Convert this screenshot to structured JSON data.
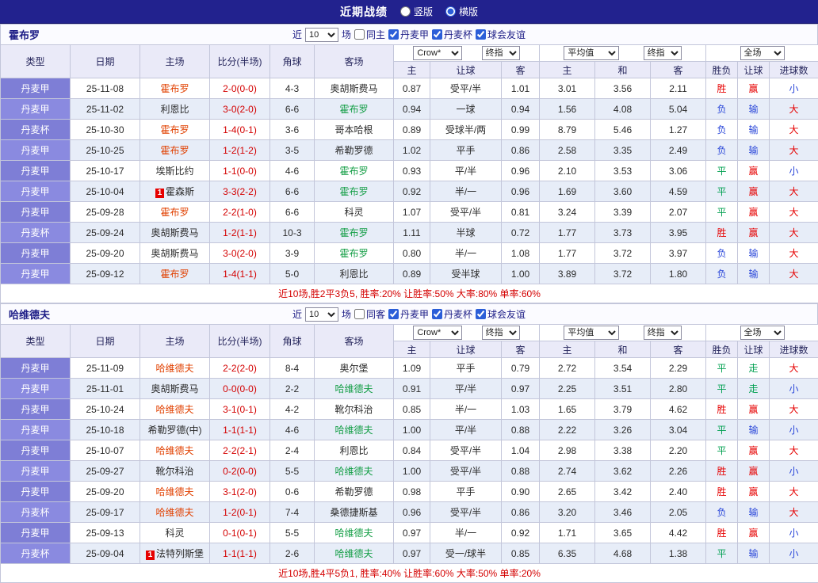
{
  "topbar": {
    "title": "近期战绩",
    "vertical_label": "竖版",
    "horizontal_label": "横版",
    "vertical_checked": false,
    "horizontal_checked": true
  },
  "columns": {
    "type": "类型",
    "date": "日期",
    "home": "主场",
    "score": "比分(半场)",
    "corner": "角球",
    "away": "客场",
    "asian_home": "主",
    "asian_line": "让球",
    "asian_away": "客",
    "euro_home": "主",
    "euro_draw": "和",
    "euro_away": "客",
    "outcome": "胜负",
    "handicap_result": "让球",
    "goals": "进球数"
  },
  "colors": {
    "topbar_bg": "#22228e",
    "type_cell": "#7e7ed6",
    "alt_row": "#e7edf8",
    "win_red": "#e60000",
    "draw_green": "#00a050",
    "lose_blue": "#2946d9",
    "score_red": "#d40000",
    "home_team_red": "#e14000",
    "away_team_green": "#149e46"
  },
  "sections": [
    {
      "team": "霍布罗",
      "filter": {
        "near": "近",
        "count": "10",
        "games": "场",
        "items": [
          {
            "label": "同主",
            "checked": false
          },
          {
            "label": "丹麦甲",
            "checked": true
          },
          {
            "label": "丹麦杯",
            "checked": true
          },
          {
            "label": "球会友谊",
            "checked": true
          }
        ]
      },
      "dropdowns": {
        "bookmaker": "Crow*",
        "asian_index": "终指",
        "euro_source": "平均值",
        "euro_index": "终指",
        "scope": "全场"
      },
      "rows": [
        {
          "type": "丹麦甲",
          "date": "25-11-08",
          "home": "霍布罗",
          "home_color": "red",
          "score": "2-0(0-0)",
          "corner": "4-3",
          "away": "奥胡斯费马",
          "ah": "0.87",
          "line": "受平/半",
          "aa": "1.01",
          "eh": "3.01",
          "ed": "3.56",
          "ea": "2.11",
          "wl": "胜",
          "hr": "赢",
          "goals": "小"
        },
        {
          "type": "丹麦甲",
          "date": "25-11-02",
          "home": "利恩比",
          "score": "3-0(2-0)",
          "corner": "6-6",
          "away": "霍布罗",
          "away_color": "green",
          "ah": "0.94",
          "line": "一球",
          "aa": "0.94",
          "eh": "1.56",
          "ed": "4.08",
          "ea": "5.04",
          "wl": "负",
          "hr": "输",
          "goals": "大"
        },
        {
          "type": "丹麦杯",
          "date": "25-10-30",
          "home": "霍布罗",
          "home_color": "red",
          "score": "1-4(0-1)",
          "corner": "3-6",
          "away": "哥本哈根",
          "ah": "0.89",
          "line": "受球半/两",
          "aa": "0.99",
          "eh": "8.79",
          "ed": "5.46",
          "ea": "1.27",
          "wl": "负",
          "hr": "输",
          "goals": "大"
        },
        {
          "type": "丹麦甲",
          "date": "25-10-25",
          "home": "霍布罗",
          "home_color": "red",
          "score": "1-2(1-2)",
          "corner": "3-5",
          "away": "希勒罗德",
          "ah": "1.02",
          "line": "平手",
          "aa": "0.86",
          "eh": "2.58",
          "ed": "3.35",
          "ea": "2.49",
          "wl": "负",
          "hr": "输",
          "goals": "大"
        },
        {
          "type": "丹麦甲",
          "date": "25-10-17",
          "home": "埃斯比约",
          "score": "1-1(0-0)",
          "corner": "4-6",
          "away": "霍布罗",
          "away_color": "green",
          "ah": "0.93",
          "line": "平/半",
          "aa": "0.96",
          "eh": "2.10",
          "ed": "3.53",
          "ea": "3.06",
          "wl": "平",
          "hr": "赢",
          "goals": "小"
        },
        {
          "type": "丹麦甲",
          "date": "25-10-04",
          "home": "霍森斯",
          "home_badge": "1",
          "score": "3-3(2-2)",
          "corner": "6-6",
          "away": "霍布罗",
          "away_color": "green",
          "ah": "0.92",
          "line": "半/一",
          "aa": "0.96",
          "eh": "1.69",
          "ed": "3.60",
          "ea": "4.59",
          "wl": "平",
          "hr": "赢",
          "goals": "大"
        },
        {
          "type": "丹麦甲",
          "date": "25-09-28",
          "home": "霍布罗",
          "home_color": "red",
          "score": "2-2(1-0)",
          "corner": "6-6",
          "away": "科灵",
          "ah": "1.07",
          "line": "受平/半",
          "aa": "0.81",
          "eh": "3.24",
          "ed": "3.39",
          "ea": "2.07",
          "wl": "平",
          "hr": "赢",
          "goals": "大"
        },
        {
          "type": "丹麦杯",
          "date": "25-09-24",
          "home": "奥胡斯费马",
          "score": "1-2(1-1)",
          "corner": "10-3",
          "away": "霍布罗",
          "away_color": "green",
          "ah": "1.11",
          "line": "半球",
          "aa": "0.72",
          "eh": "1.77",
          "ed": "3.73",
          "ea": "3.95",
          "wl": "胜",
          "hr": "赢",
          "goals": "大"
        },
        {
          "type": "丹麦甲",
          "date": "25-09-20",
          "home": "奥胡斯费马",
          "score": "3-0(2-0)",
          "corner": "3-9",
          "away": "霍布罗",
          "away_color": "green",
          "ah": "0.80",
          "line": "半/一",
          "aa": "1.08",
          "eh": "1.77",
          "ed": "3.72",
          "ea": "3.97",
          "wl": "负",
          "hr": "输",
          "goals": "大"
        },
        {
          "type": "丹麦甲",
          "date": "25-09-12",
          "home": "霍布罗",
          "home_color": "red",
          "score": "1-4(1-1)",
          "corner": "5-0",
          "away": "利恩比",
          "ah": "0.89",
          "line": "受半球",
          "aa": "1.00",
          "eh": "3.89",
          "ed": "3.72",
          "ea": "1.80",
          "wl": "负",
          "hr": "输",
          "goals": "大"
        }
      ],
      "summary": "近10场,胜2平3负5, 胜率:20% 让胜率:50% 大率:80% 单率:60%"
    },
    {
      "team": "哈维德夫",
      "filter": {
        "near": "近",
        "count": "10",
        "games": "场",
        "items": [
          {
            "label": "同客",
            "checked": false
          },
          {
            "label": "丹麦甲",
            "checked": true
          },
          {
            "label": "丹麦杯",
            "checked": true
          },
          {
            "label": "球会友谊",
            "checked": true
          }
        ]
      },
      "dropdowns": {
        "bookmaker": "Crow*",
        "asian_index": "终指",
        "euro_source": "平均值",
        "euro_index": "终指",
        "scope": "全场"
      },
      "rows": [
        {
          "type": "丹麦甲",
          "date": "25-11-09",
          "home": "哈维德夫",
          "home_color": "red",
          "score": "2-2(2-0)",
          "corner": "8-4",
          "away": "奥尔堡",
          "ah": "1.09",
          "line": "平手",
          "aa": "0.79",
          "eh": "2.72",
          "ed": "3.54",
          "ea": "2.29",
          "wl": "平",
          "hr": "走",
          "goals": "大"
        },
        {
          "type": "丹麦甲",
          "date": "25-11-01",
          "home": "奥胡斯费马",
          "score": "0-0(0-0)",
          "corner": "2-2",
          "away": "哈维德夫",
          "away_color": "green",
          "ah": "0.91",
          "line": "平/半",
          "aa": "0.97",
          "eh": "2.25",
          "ed": "3.51",
          "ea": "2.80",
          "wl": "平",
          "hr": "走",
          "goals": "小"
        },
        {
          "type": "丹麦甲",
          "date": "25-10-24",
          "home": "哈维德夫",
          "home_color": "red",
          "score": "3-1(0-1)",
          "corner": "4-2",
          "away": "靴尔科治",
          "ah": "0.85",
          "line": "半/一",
          "aa": "1.03",
          "eh": "1.65",
          "ed": "3.79",
          "ea": "4.62",
          "wl": "胜",
          "hr": "赢",
          "goals": "大"
        },
        {
          "type": "丹麦甲",
          "date": "25-10-18",
          "home": "希勒罗德(中)",
          "score": "1-1(1-1)",
          "corner": "4-6",
          "away": "哈维德夫",
          "away_color": "green",
          "ah": "1.00",
          "line": "平/半",
          "aa": "0.88",
          "eh": "2.22",
          "ed": "3.26",
          "ea": "3.04",
          "wl": "平",
          "hr": "输",
          "goals": "小"
        },
        {
          "type": "丹麦甲",
          "date": "25-10-07",
          "home": "哈维德夫",
          "home_color": "red",
          "score": "2-2(2-1)",
          "corner": "2-4",
          "away": "利恩比",
          "ah": "0.84",
          "line": "受平/半",
          "aa": "1.04",
          "eh": "2.98",
          "ed": "3.38",
          "ea": "2.20",
          "wl": "平",
          "hr": "赢",
          "goals": "大"
        },
        {
          "type": "丹麦甲",
          "date": "25-09-27",
          "home": "靴尔科治",
          "score": "0-2(0-0)",
          "corner": "5-5",
          "away": "哈维德夫",
          "away_color": "green",
          "ah": "1.00",
          "line": "受平/半",
          "aa": "0.88",
          "eh": "2.74",
          "ed": "3.62",
          "ea": "2.26",
          "wl": "胜",
          "hr": "赢",
          "goals": "小"
        },
        {
          "type": "丹麦甲",
          "date": "25-09-20",
          "home": "哈维德夫",
          "home_color": "red",
          "score": "3-1(2-0)",
          "corner": "0-6",
          "away": "希勒罗德",
          "ah": "0.98",
          "line": "平手",
          "aa": "0.90",
          "eh": "2.65",
          "ed": "3.42",
          "ea": "2.40",
          "wl": "胜",
          "hr": "赢",
          "goals": "大"
        },
        {
          "type": "丹麦杯",
          "date": "25-09-17",
          "home": "哈维德夫",
          "home_color": "red",
          "score": "1-2(0-1)",
          "corner": "7-4",
          "away": "桑德捷斯基",
          "ah": "0.96",
          "line": "受平/半",
          "aa": "0.86",
          "eh": "3.20",
          "ed": "3.46",
          "ea": "2.05",
          "wl": "负",
          "hr": "输",
          "goals": "大"
        },
        {
          "type": "丹麦甲",
          "date": "25-09-13",
          "home": "科灵",
          "score": "0-1(0-1)",
          "corner": "5-5",
          "away": "哈维德夫",
          "away_color": "green",
          "ah": "0.97",
          "line": "半/一",
          "aa": "0.92",
          "eh": "1.71",
          "ed": "3.65",
          "ea": "4.42",
          "wl": "胜",
          "hr": "赢",
          "goals": "小"
        },
        {
          "type": "丹麦杯",
          "date": "25-09-04",
          "home": "法特列斯堡",
          "home_badge": "1",
          "score": "1-1(1-1)",
          "corner": "2-6",
          "away": "哈维德夫",
          "away_color": "green",
          "ah": "0.97",
          "line": "受一/球半",
          "aa": "0.85",
          "eh": "6.35",
          "ed": "4.68",
          "ea": "1.38",
          "wl": "平",
          "hr": "输",
          "goals": "小"
        }
      ],
      "summary": "近10场,胜4平5负1, 胜率:40% 让胜率:60% 大率:50% 单率:20%"
    }
  ]
}
